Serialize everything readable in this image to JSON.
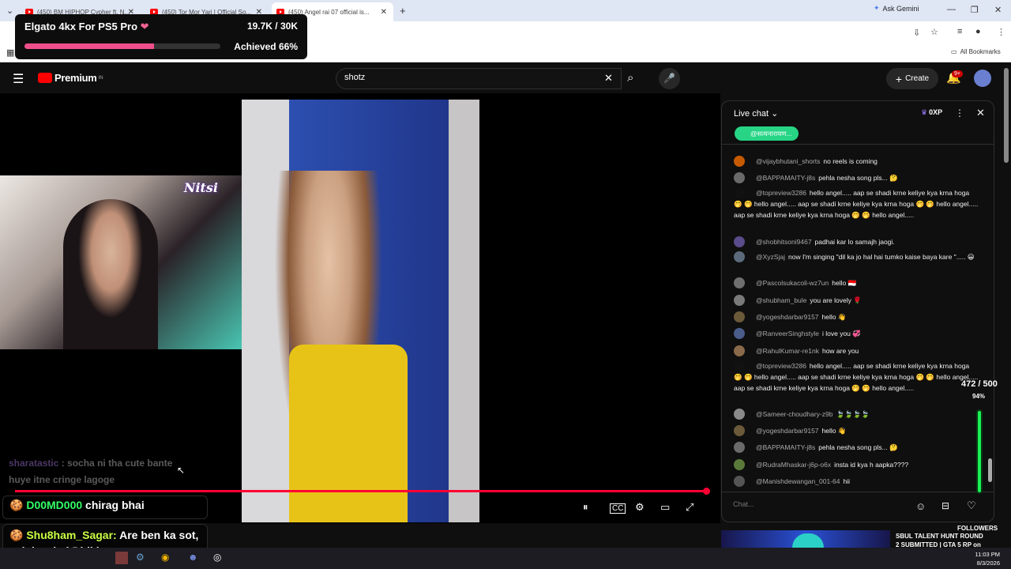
{
  "browser": {
    "tabs": [
      {
        "label": "(450) BM HIPHOP Cypher ft. N..."
      },
      {
        "label": "(450) Tor Mor Yari | Official So..."
      },
      {
        "label": "(450) Angel rai 07 official is..."
      }
    ],
    "ask_gemini": "Ask Gemini",
    "all_bookmarks": "All Bookmarks"
  },
  "goal_overlay": {
    "title": "Elgato 4kx For PS5 Pro",
    "amount": "19.7K / 30K",
    "achieved": "Achieved 66%",
    "progress": 0.66
  },
  "youtube": {
    "logo": "Premium",
    "region": "IN",
    "search_value": "shotz",
    "create_label": "Create",
    "notif_badge": "9+"
  },
  "stream_overlay": {
    "cam_logo": "Nitsi",
    "faded_message_author": "sharatastic",
    "faded_message": ": socha ni tha cute bante huye itne cringe lagoge",
    "msg1_author": "D00MD000",
    "msg1_text": "chirag bhai",
    "msg2_author": "Shu8ham_Sagar:",
    "msg2_text": "Are ben ka sot, yeh kya hai Didi ka",
    "meter_label": "472 / 500",
    "meter_pct": "94%",
    "meter_level": 0.94,
    "followers": "FOLLOWERS",
    "banner_text_line1": "SBUL TALENT HUNT ROUND",
    "banner_text_line2": "2 SUBMITTED | GTA 5 RP on"
  },
  "live_chat": {
    "title": "Live chat",
    "xp": "0XP",
    "pinned_chip": "@सत्यनारायण...",
    "input_placeholder": "Chat...",
    "messages": [
      {
        "author": "@vijaybhutani_shorts",
        "text": "no reels is coming",
        "color": "#c65a00"
      },
      {
        "author": "@BAPPAMAITY-j8s",
        "text": "pehla nesha song pls... 🤔",
        "color": "#6a6a6a"
      },
      {
        "author": "@topreview3286",
        "text": "hello angel..... aap se shadi krne keliye kya krna hoga 🤭 🤭 hello angel..... aap se shadi krne keliye kya krna hoga 🤭 🤭 hello angel..... aap se shadi krne keliye kya krna hoga 🤭 🤭 hello angel.....",
        "color": "#111111"
      },
      {
        "author": "@shobhitsoni9467",
        "text": "padhai kar lo samajh jaogi.",
        "color": "#5a4b8a"
      },
      {
        "author": "@XyzSjaj",
        "text": "now I'm singing \"dil ka jo hal hai tumko kaise baya kare \"..... 😀",
        "color": "#5c6b7c"
      },
      {
        "author": "@Pascolsukacoli-wz7un",
        "text": "hello 🇮🇩",
        "color": "#6f6f6f"
      },
      {
        "author": "@shubham_bule",
        "text": "you are lovely 🌹",
        "color": "#7a7a7a"
      },
      {
        "author": "@yogeshdarbar9157",
        "text": "hello 👋",
        "color": "#6b5a3a"
      },
      {
        "author": "@RanveerSinghstyle",
        "text": "i love you 💞",
        "color": "#4a5c8a"
      },
      {
        "author": "@RahulKumar-re1nk",
        "text": "how are you",
        "color": "#8a6a4a"
      },
      {
        "author": "@topreview3286",
        "text": "hello angel..... aap se shadi krne keliye kya krna hoga 🤭 🤭 hello angel..... aap se shadi krne keliye kya krna hoga 🤭 🤭 hello angel..... aap se shadi krne keliye kya krna hoga 🤭 🤭 hello angel.....",
        "color": "#111111"
      },
      {
        "author": "@Sameer-choudhary-z9b",
        "text": "🍃🍃🍃🍃",
        "color": "#8a8a8a"
      },
      {
        "author": "@yogeshdarbar9157",
        "text": "hello 👋",
        "color": "#6b5a3a"
      },
      {
        "author": "@BAPPAMAITY-j8s",
        "text": "pehla nesha song pls... 🤔",
        "color": "#6a6a6a"
      },
      {
        "author": "@RudraMhaskar-j6p-o6x",
        "text": "insta id kya h aapka????",
        "color": "#5a7a3a"
      },
      {
        "author": "@Manishdewangan_001-64",
        "text": "hii",
        "color": "#555555"
      }
    ]
  },
  "taskbar": {
    "time": "11:03 PM",
    "date": "8/3/2026"
  },
  "colors": {
    "accent": "#ff0033",
    "goal_fill": "#ee4f8a",
    "meter": "#1aff5a"
  }
}
